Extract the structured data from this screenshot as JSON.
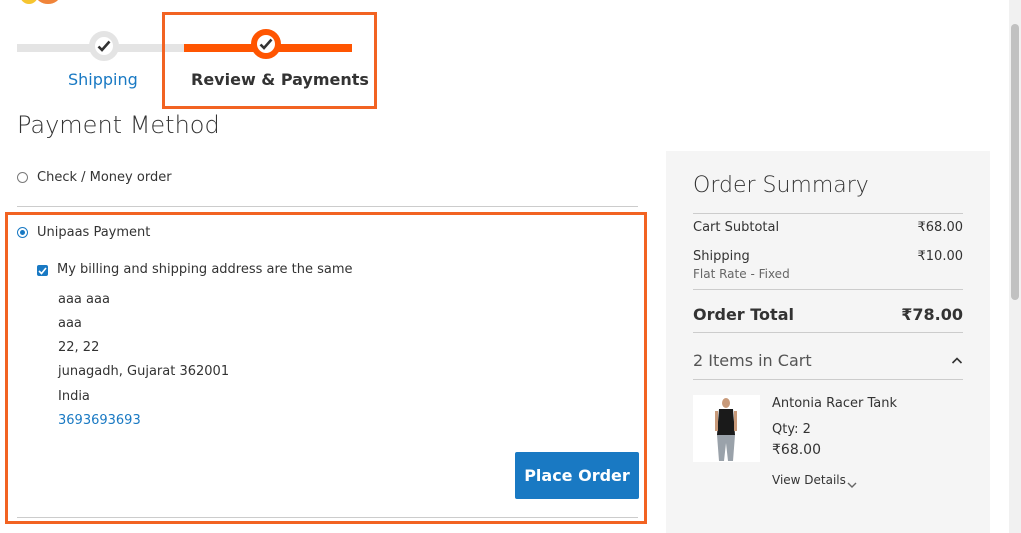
{
  "progress": {
    "steps": [
      {
        "label": "Shipping",
        "state": "complete"
      },
      {
        "label": "Review & Payments",
        "state": "current"
      }
    ]
  },
  "payment": {
    "title": "Payment Method",
    "methods": [
      {
        "label": "Check / Money order",
        "selected": false
      },
      {
        "label": "Unipaas Payment",
        "selected": true
      }
    ],
    "same_address_label": "My billing and shipping address are the same",
    "same_address_checked": true,
    "address": {
      "name": "aaa aaa",
      "company": "aaa",
      "street": "22, 22",
      "city_region_zip": "junagadh, Gujarat 362001",
      "country": "India",
      "phone": "3693693693"
    },
    "place_order_label": "Place Order"
  },
  "summary": {
    "title": "Order Summary",
    "cart_subtotal_label": "Cart Subtotal",
    "cart_subtotal_value": "₹68.00",
    "shipping_label": "Shipping",
    "shipping_method": "Flat Rate - Fixed",
    "shipping_value": "₹10.00",
    "order_total_label": "Order Total",
    "order_total_value": "₹78.00",
    "items_in_cart_label": "2 Items in Cart",
    "item": {
      "name": "Antonia Racer Tank",
      "qty_label": "Qty: 2",
      "price": "₹68.00",
      "view_details_label": "View Details"
    }
  },
  "colors": {
    "accent": "#ff5501",
    "highlight_border": "#f26322",
    "primary_button": "#1979c3",
    "link": "#1979c3"
  }
}
